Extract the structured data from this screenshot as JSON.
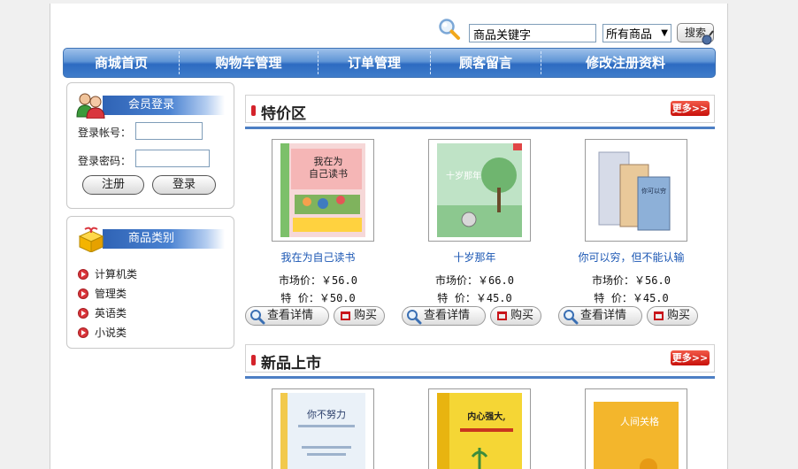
{
  "search": {
    "keyword_value": "商品关键字",
    "category_selected": "所有商品",
    "button_label": "搜索"
  },
  "nav": {
    "items": [
      "商城首页",
      "购物车管理",
      "订单管理",
      "顾客留言",
      "修改注册资料"
    ]
  },
  "login_panel": {
    "title": "会员登录",
    "account_label": "登录帐号：",
    "password_label": "登录密码：",
    "register_label": "注册",
    "login_label": "登录"
  },
  "category_panel": {
    "title": "商品类别",
    "items": [
      "计算机类",
      "管理类",
      "英语类",
      "小说类"
    ]
  },
  "specials": {
    "title": "特价区",
    "more_label": "更多>>",
    "products": [
      {
        "name": "我在为自己读书",
        "cover_text": "我在为自己读书",
        "market_label": "市场价：",
        "market_price": "￥56.0",
        "special_label": "特  价：",
        "special_price": "￥50.0",
        "detail_label": "查看详情",
        "buy_label": "购买"
      },
      {
        "name": "十岁那年",
        "cover_text": "十岁那年",
        "market_label": "市场价：",
        "market_price": "￥66.0",
        "special_label": "特  价：",
        "special_price": "￥45.0",
        "detail_label": "查看详情",
        "buy_label": "购买"
      },
      {
        "name": "你可以穷，但不能认输",
        "cover_text": "你可以穷",
        "market_label": "市场价：",
        "market_price": "￥56.0",
        "special_label": "特  价：",
        "special_price": "￥45.0",
        "detail_label": "查看详情",
        "buy_label": "购买"
      }
    ]
  },
  "new_arrivals": {
    "title": "新品上市",
    "more_label": "更多>>",
    "products": [
      {
        "cover_text": "你不努力"
      },
      {
        "cover_text": "内心强大,"
      },
      {
        "cover_text": "人间关格"
      }
    ]
  },
  "colors": {
    "nav_blue": "#2d6bc1",
    "link_blue": "#1a56b3",
    "accent_red": "#d4232b"
  }
}
